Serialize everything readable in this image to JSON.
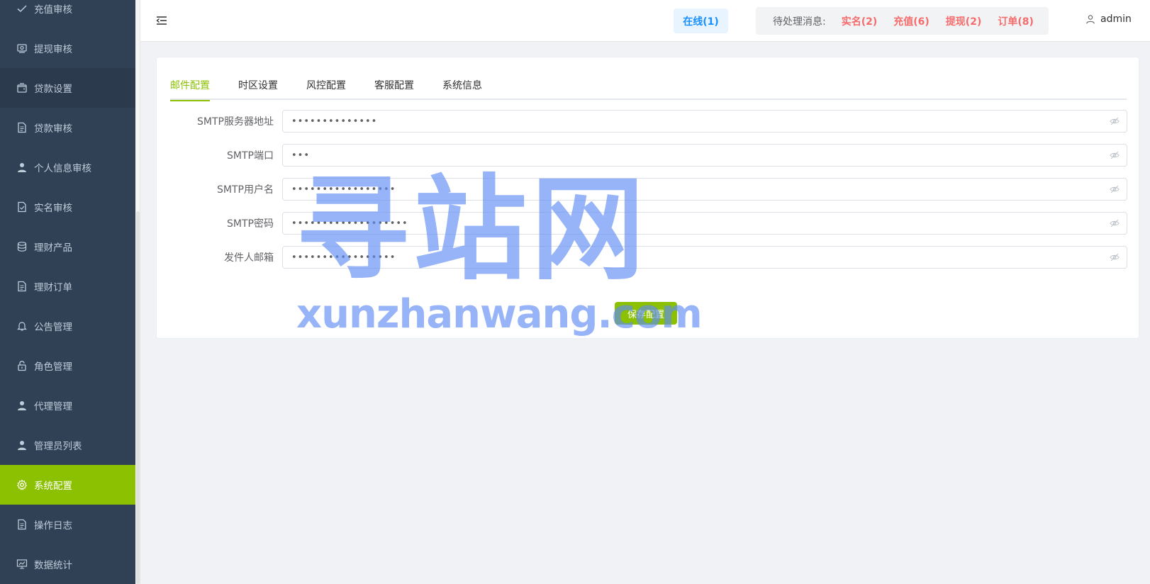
{
  "sidebar": {
    "items": [
      {
        "label": "充值审核",
        "icon": "check-icon"
      },
      {
        "label": "提现审核",
        "icon": "wallet-icon"
      },
      {
        "label": "贷款设置",
        "icon": "folder-icon"
      },
      {
        "label": "贷款审核",
        "icon": "document-icon"
      },
      {
        "label": "个人信息审核",
        "icon": "user-icon"
      },
      {
        "label": "实名审核",
        "icon": "document-check-icon"
      },
      {
        "label": "理财产品",
        "icon": "coins-icon"
      },
      {
        "label": "理财订单",
        "icon": "document-icon"
      },
      {
        "label": "公告管理",
        "icon": "bell-icon"
      },
      {
        "label": "角色管理",
        "icon": "lock-icon"
      },
      {
        "label": "代理管理",
        "icon": "user-icon"
      },
      {
        "label": "管理员列表",
        "icon": "user-icon"
      },
      {
        "label": "系统配置",
        "icon": "gear-icon"
      },
      {
        "label": "操作日志",
        "icon": "document-icon"
      },
      {
        "label": "数据统计",
        "icon": "chart-icon"
      }
    ],
    "active": "系统配置"
  },
  "header": {
    "online": "在线(1)",
    "pending_label": "待处理消息:",
    "pending": [
      {
        "label": "实名(2)"
      },
      {
        "label": "充值(6)"
      },
      {
        "label": "提现(2)"
      },
      {
        "label": "订单(8)"
      }
    ],
    "username": "admin"
  },
  "tabs": [
    "邮件配置",
    "时区设置",
    "风控配置",
    "客服配置",
    "系统信息"
  ],
  "active_tab": "邮件配置",
  "form": {
    "fields": [
      {
        "label": "SMTP服务器地址",
        "value": "••••••••••••••"
      },
      {
        "label": "SMTP端口",
        "value": "•••"
      },
      {
        "label": "SMTP用户名",
        "value": "•••••••••••••••••"
      },
      {
        "label": "SMTP密码",
        "value": "•••••••••••••••••••"
      },
      {
        "label": "发件人邮箱",
        "value": "•••••••••••••••••"
      }
    ],
    "save_label": "保存配置"
  },
  "watermark": {
    "cn": "寻站网",
    "en": "xunzhanwang.com"
  },
  "colors": {
    "sidebar_bg": "#304156",
    "accent": "#8bc100",
    "alert": "#f56c6c",
    "online": "#1890ff"
  }
}
